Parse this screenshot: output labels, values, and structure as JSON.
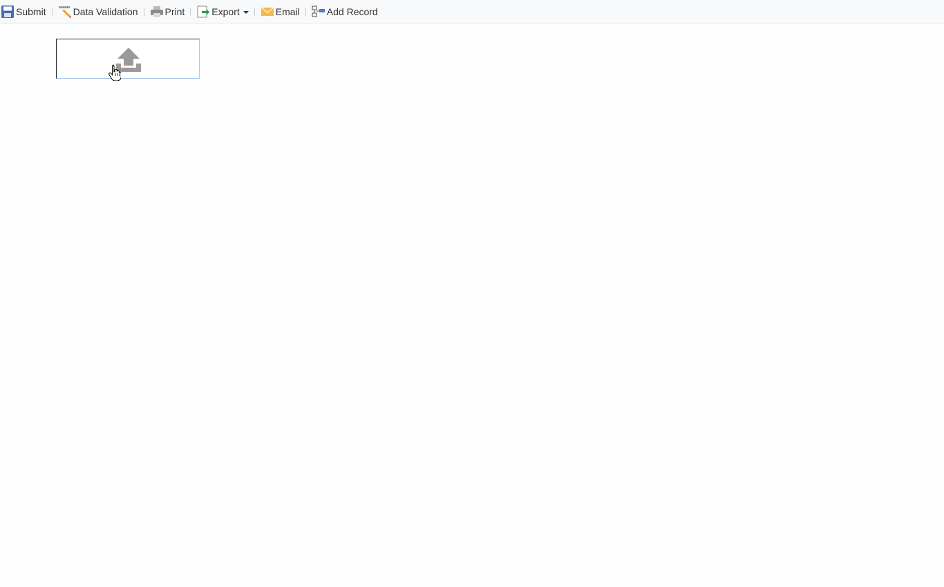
{
  "toolbar": {
    "submit_label": "Submit",
    "validation_label": "Data Validation",
    "print_label": "Print",
    "export_label": "Export",
    "email_label": "Email",
    "add_record_label": "Add Record"
  },
  "icons": {
    "submit": "save-icon",
    "validation": "ruler-pencil-icon",
    "print": "printer-icon",
    "export": "export-icon",
    "email": "envelope-icon",
    "add_record": "add-record-icon",
    "upload": "upload-icon"
  },
  "colors": {
    "toolbar_bg": "#f8f9fb",
    "upload_icon": "#9a9a9a",
    "upload_border": "#a9c9ea"
  }
}
